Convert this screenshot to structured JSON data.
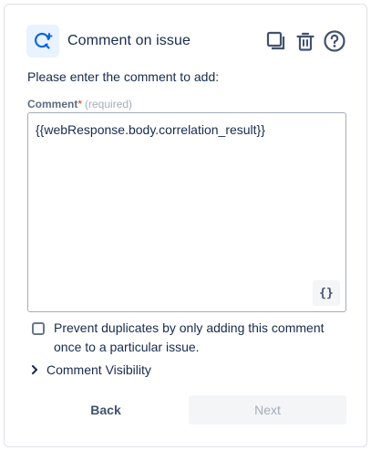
{
  "header": {
    "title": "Comment on issue",
    "icon": "comment-add-icon",
    "actions": [
      "duplicate-icon",
      "delete-icon",
      "help-icon"
    ]
  },
  "form": {
    "prompt": "Please enter the comment to add:",
    "comment_label": "Comment",
    "required_star": "*",
    "required_text": "(required)",
    "comment_value": "{{webResponse.body.correlation_result}}",
    "smart_value_button": "{}",
    "prevent_duplicates": {
      "checked": false,
      "label": "Prevent duplicates by only adding this comment once to a particular issue."
    },
    "visibility_label": "Comment Visibility"
  },
  "footer": {
    "back_label": "Back",
    "next_label": "Next"
  },
  "colors": {
    "accent": "#0c66e4",
    "icon_bg": "#e9f2ff",
    "text": "#172b4d",
    "disabled_text": "#a5adba"
  }
}
